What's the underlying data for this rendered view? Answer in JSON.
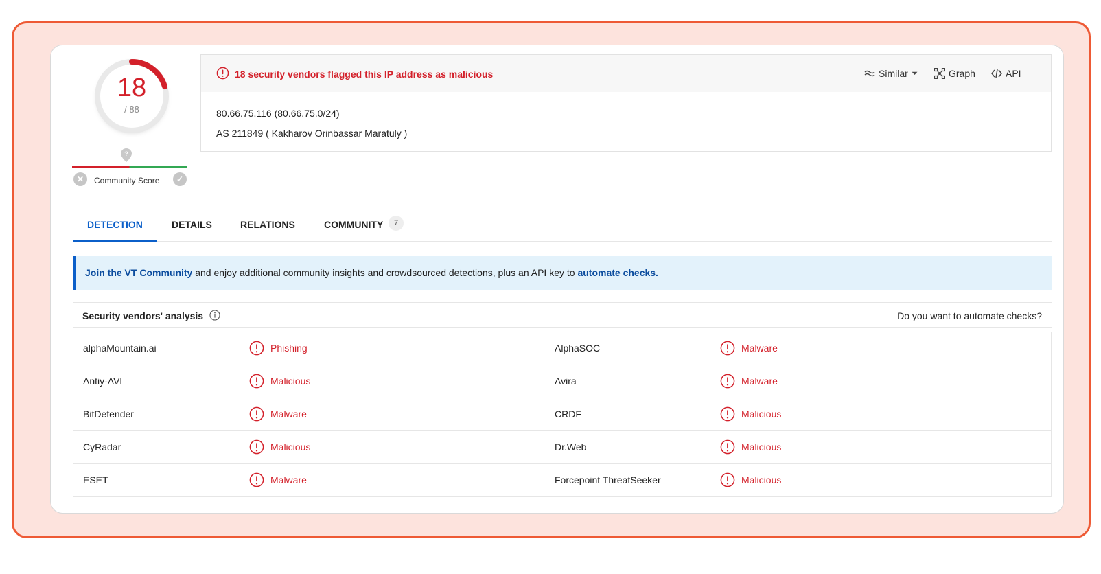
{
  "score": {
    "detections": "18",
    "total": "/ 88",
    "fraction": 0.2045
  },
  "community": {
    "label": "Community Score"
  },
  "alert": {
    "text": "18 security vendors flagged this IP address as malicious"
  },
  "actions": {
    "similar": "Similar",
    "graph": "Graph",
    "api": "API"
  },
  "ip": {
    "address_line": "80.66.75.116  (80.66.75.0/24)",
    "as_line": "AS 211849  ( Kakharov Orinbassar Maratuly )"
  },
  "tabs": {
    "detection": "DETECTION",
    "details": "DETAILS",
    "relations": "RELATIONS",
    "community": "COMMUNITY",
    "community_count": "7"
  },
  "banner": {
    "link1": "Join the VT Community",
    "middle": " and enjoy additional community insights and crowdsourced detections, plus an API key to ",
    "link2": "automate checks."
  },
  "vendors": {
    "title": "Security vendors' analysis",
    "right_prompt": "Do you want to automate checks?",
    "rows": [
      {
        "v1": "alphaMountain.ai",
        "r1": "Phishing",
        "v2": "AlphaSOC",
        "r2": "Malware"
      },
      {
        "v1": "Antiy-AVL",
        "r1": "Malicious",
        "v2": "Avira",
        "r2": "Malware"
      },
      {
        "v1": "BitDefender",
        "r1": "Malware",
        "v2": "CRDF",
        "r2": "Malicious"
      },
      {
        "v1": "CyRadar",
        "r1": "Malicious",
        "v2": "Dr.Web",
        "r2": "Malicious"
      },
      {
        "v1": "ESET",
        "r1": "Malware",
        "v2": "Forcepoint ThreatSeeker",
        "r2": "Malicious"
      }
    ]
  },
  "colors": {
    "malicious": "#d3202a",
    "accent": "#0b5fc9",
    "frame": "#ee5a35",
    "frame_bg": "#fde3dd"
  }
}
